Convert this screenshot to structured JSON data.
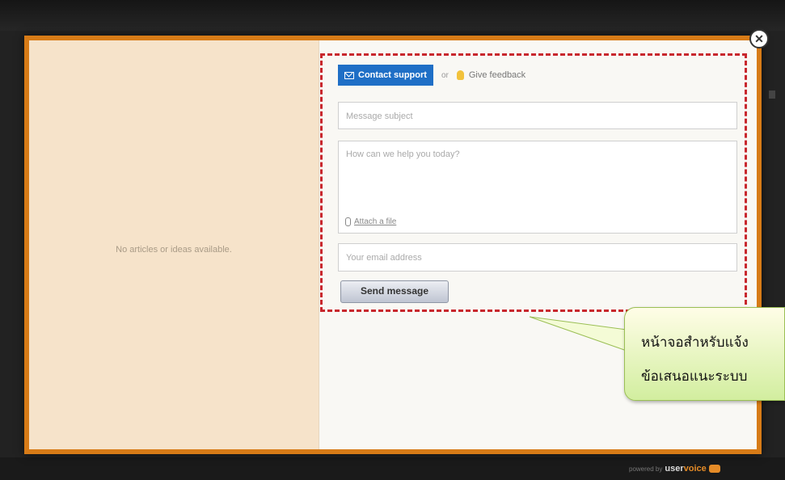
{
  "background_nav": {
    "items": [
      "",
      "",
      "",
      "",
      "",
      ""
    ]
  },
  "left_pane": {
    "empty_text": "No articles or ideas available."
  },
  "tabs": {
    "contact_label": "Contact support",
    "or_label": "or",
    "idea_label": "Give feedback"
  },
  "form": {
    "subject_placeholder": "Message subject",
    "description_placeholder": "How can we help you today?",
    "attach_label": "Attach a file",
    "email_placeholder": "Your email address",
    "send_label": "Send message"
  },
  "callout": {
    "line1": "หน้าจอสำหรับแจ้ง",
    "line2": "ข้อเสนอแนะระบบ"
  },
  "footer": {
    "powered_text": "powered by",
    "brand_prefix": "user",
    "brand_suffix": "voice"
  },
  "colors": {
    "accent_orange": "#d77b17",
    "tab_blue": "#1f6fc6",
    "highlight_red": "#c8272d",
    "callout_green": "#d2ee9f"
  }
}
